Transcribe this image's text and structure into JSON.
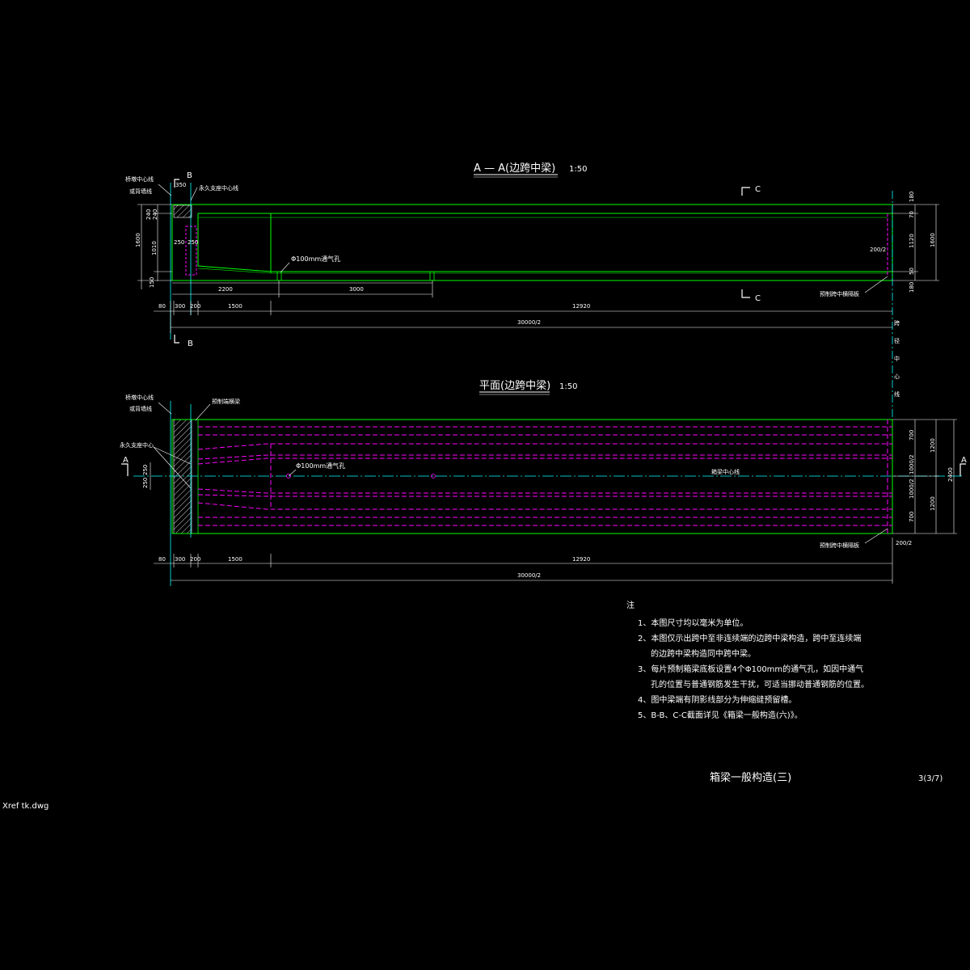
{
  "section_view": {
    "title": "A — A(边跨中梁)",
    "scale": "1:50",
    "labels": {
      "deck_center": "桥墩中心线",
      "or_abutment": "或背墙线",
      "support_center": "永久支座中心线",
      "vent_hole": "Φ100mm通气孔",
      "precast_diaphragm": "预制跨中横隔板"
    },
    "cut_marks": {
      "b_top": "B",
      "b_bottom": "B",
      "c_top": "C",
      "c_bottom": "C"
    },
    "dims_left": [
      "1600",
      "1010",
      "240",
      "240",
      "250",
      "250",
      "150"
    ],
    "dims_top": [
      "350"
    ],
    "dims_right": [
      "180",
      "70",
      "1120",
      "50",
      "180",
      "1600",
      "200/2"
    ],
    "dims_inner": [
      "2200",
      "3000"
    ],
    "dims_bottom": [
      "80",
      "300",
      "200",
      "1500",
      "12920"
    ],
    "total": "30000/2"
  },
  "plan_view": {
    "title": "平面(边跨中梁)",
    "scale": "1:50",
    "labels": {
      "deck_center": "桥墩中心线",
      "or_abutment": "或背墙线",
      "precast_end_diaphragm": "预制端横梁",
      "support_center": "永久支座中心",
      "vent_hole": "Φ100mm通气孔",
      "beam_centerline": "箱梁中心线",
      "precast_diaphragm": "预制跨中横隔板"
    },
    "cut_marks": {
      "a_left": "A",
      "a_right": "A"
    },
    "dims_left": [
      "250",
      "250"
    ],
    "dims_right": [
      "700",
      "1200",
      "1000/2",
      "1000/2",
      "700",
      "1200",
      "2400",
      "200/2"
    ],
    "dims_bottom": [
      "80",
      "300",
      "200",
      "1500",
      "12920"
    ],
    "total": "30000/2"
  },
  "span_center_vertical": "跨径中心线",
  "notes": {
    "heading": "注",
    "items": [
      "1、本图尺寸均以毫米为单位。",
      "2、本图仅示出跨中至非连续端的边跨中梁构造，跨中至连续端",
      "的边跨中梁构造同中跨中梁。",
      "3、每片预制箱梁底板设置4个Φ100mm的通气孔，如因中通气",
      "孔的位置与普通钢筋发生干扰，可适当挪动普通钢筋的位置。",
      "4、图中梁端有阴影线部分为伸缩缝预留槽。",
      "5、B-B、C-C截面详见《箱梁一般构造(六)》。"
    ]
  },
  "title_block": {
    "name": "箱梁一般构造(三)",
    "sheet": "3(3/7)"
  },
  "xref": "Xref tk.dwg",
  "colors": {
    "green": "#00ff00",
    "magenta": "#ff00ff",
    "cyan": "#00ffff",
    "white": "#ffffff",
    "background": "#000000"
  }
}
